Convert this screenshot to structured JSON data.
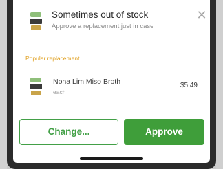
{
  "header": {
    "title": "Sometimes out of stock",
    "subtitle": "Approve a replacement just in case",
    "close_icon": "close-icon"
  },
  "replacement": {
    "section_label": "Popular replacement",
    "item": {
      "name": "Nona Lim Miso Broth",
      "unit": "each",
      "price": "$5.49",
      "icon": "product-image"
    }
  },
  "actions": {
    "change_label": "Change...",
    "approve_label": "Approve"
  },
  "colors": {
    "accent_green": "#3f9e3a",
    "label_orange": "#e0a020"
  }
}
